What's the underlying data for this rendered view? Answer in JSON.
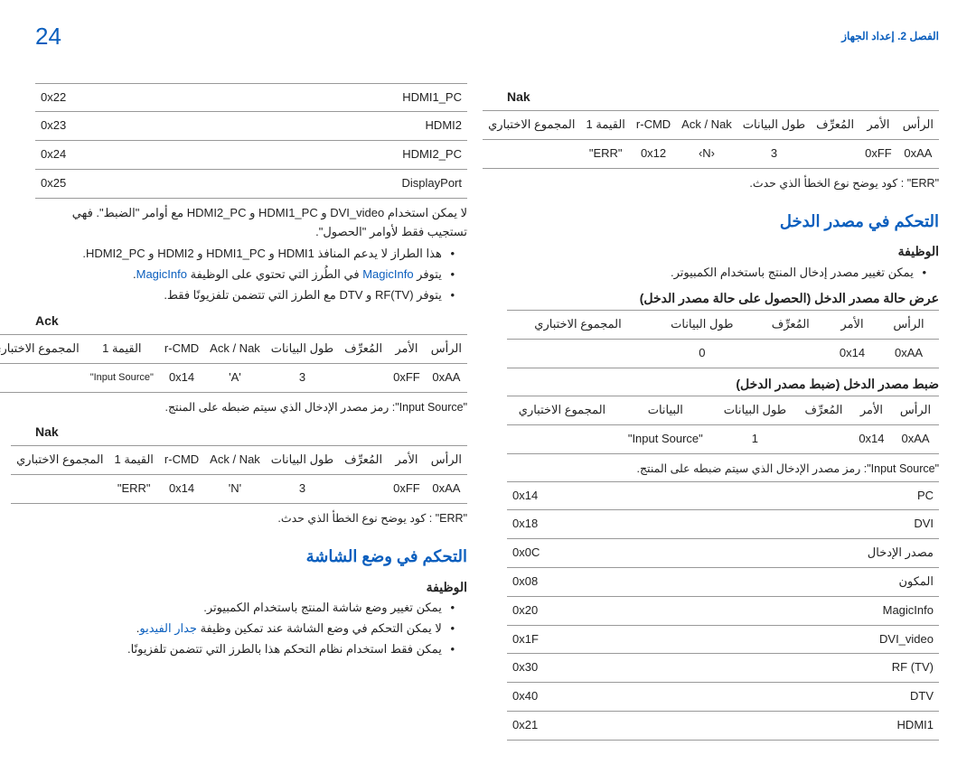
{
  "top": {
    "page_number": "24",
    "chapter": "الفصل 2. إعداد الجهاز"
  },
  "right": {
    "nak_title": "Nak",
    "nak_hdr": {
      "c1": "الرأس",
      "c2": "الأمر",
      "c3": "المُعرِّف",
      "c4": "طول البيانات",
      "c5": "Ack / Nak",
      "c6": "r-CMD",
      "c7": "القيمة 1",
      "c8": "المجموع الاختباري"
    },
    "nak_row": {
      "c1": "0xAA",
      "c2": "0xFF",
      "c3": "",
      "c4": "3",
      "c5": "‹N›",
      "c6": "0x12",
      "c7": "\"ERR\"",
      "c8": ""
    },
    "err_note": "\"ERR\" : كود يوضح نوع الخطأ الذي حدث.",
    "input_ctrl_title": "التحكم في مصدر الدخل",
    "func_title": "الوظيفة",
    "func_bullet": "يمكن تغيير مصدر إدخال المنتج باستخدام الكمبيوتر.",
    "view_title": "عرض حالة مصدر الدخل (الحصول على حالة مصدر الدخل)",
    "view_hdr": {
      "c1": "الرأس",
      "c2": "الأمر",
      "c3": "المُعرِّف",
      "c4": "طول البيانات",
      "c5": "المجموع الاختباري"
    },
    "view_row": {
      "c1": "0xAA",
      "c2": "0x14",
      "c3": "",
      "c4": "0",
      "c5": ""
    },
    "set_title": "ضبط مصدر الدخل (ضبط مصدر الدخل)",
    "set_hdr": {
      "c1": "الرأس",
      "c2": "الأمر",
      "c3": "المُعرِّف",
      "c4": "طول البيانات",
      "c5": "البيانات",
      "c6": "المجموع الاختباري"
    },
    "set_row": {
      "c1": "0xAA",
      "c2": "0x14",
      "c3": "",
      "c4": "1",
      "c5": "\"Input Source\"",
      "c6": ""
    },
    "is_note": "\"Input Source\": رمز مصدر الإدخال الذي سيتم ضبطه على المنتج.",
    "codes": [
      {
        "name": "PC",
        "val": "0x14"
      },
      {
        "name": "DVI",
        "val": "0x18"
      },
      {
        "name": "مصدر الإدخال",
        "val": "0x0C"
      },
      {
        "name": "المكون",
        "val": "0x08"
      },
      {
        "name": "MagicInfo",
        "val": "0x20"
      },
      {
        "name": "DVI_video",
        "val": "0x1F"
      },
      {
        "name": "RF (TV)",
        "val": "0x30"
      },
      {
        "name": "DTV",
        "val": "0x40"
      },
      {
        "name": "HDMI1",
        "val": "0x21"
      }
    ]
  },
  "left": {
    "codes2": [
      {
        "name": "HDMI1_PC",
        "val": "0x22"
      },
      {
        "name": "HDMI2",
        "val": "0x23"
      },
      {
        "name": "HDMI2_PC",
        "val": "0x24"
      },
      {
        "name": "DisplayPort",
        "val": "0x25"
      }
    ],
    "p1": "لا يمكن استخدام DVI_video و HDMI1_PC و HDMI2_PC مع أوامر \"الضبط\". فهي تستجيب فقط لأوامر \"الحصول\".",
    "b1": "هذا الطراز لا يدعم المنافذ HDMI1 و HDMI1_PC و HDMI2 و HDMI2_PC.",
    "b2_pre": "يتوفر ",
    "b2_link": "MagicInfo",
    "b2_post": " في الطُرز التي تحتوي على الوظيفة ",
    "b2_link2": "MagicInfo",
    "b2_end": ".",
    "b3": "يتوفر RF(TV) و DTV مع الطرز التي تتضمن تلفزيونًا فقط.",
    "ack_title": "Ack",
    "ack_hdr": {
      "c1": "الرأس",
      "c2": "الأمر",
      "c3": "المُعرِّف",
      "c4": "طول البيانات",
      "c5": "Ack / Nak",
      "c6": "r-CMD",
      "c7": "القيمة 1",
      "c8": "المجموع الاختباري"
    },
    "ack_row": {
      "c1": "0xAA",
      "c2": "0xFF",
      "c3": "",
      "c4": "3",
      "c5": "'A'",
      "c6": "0x14",
      "c7": "\"Input Source\"",
      "c8": ""
    },
    "is_note2": "\"Input Source\": رمز مصدر الإدخال الذي سيتم ضبطه على المنتج.",
    "nak_title": "Nak",
    "nak_hdr": {
      "c1": "الرأس",
      "c2": "الأمر",
      "c3": "المُعرِّف",
      "c4": "طول البيانات",
      "c5": "Ack / Nak",
      "c6": "r-CMD",
      "c7": "القيمة 1",
      "c8": "المجموع الاختباري"
    },
    "nak_row": {
      "c1": "0xAA",
      "c2": "0xFF",
      "c3": "",
      "c4": "3",
      "c5": "'N'",
      "c6": "0x14",
      "c7": "\"ERR\"",
      "c8": ""
    },
    "err_note": "\"ERR\" : كود يوضح نوع الخطأ الذي حدث.",
    "screen_title": "التحكم في وضع الشاشة",
    "screen_func_title": "الوظيفة",
    "sb1": "يمكن تغيير وضع شاشة المنتج باستخدام الكمبيوتر.",
    "sb2_pre": "لا يمكن التحكم في وضع الشاشة عند تمكين وظيفة ",
    "sb2_link": "جدار الفيديو",
    "sb2_end": ".",
    "sb3": "يمكن فقط استخدام نظام التحكم هذا بالطرز التي تتضمن تلفزيونًا."
  }
}
